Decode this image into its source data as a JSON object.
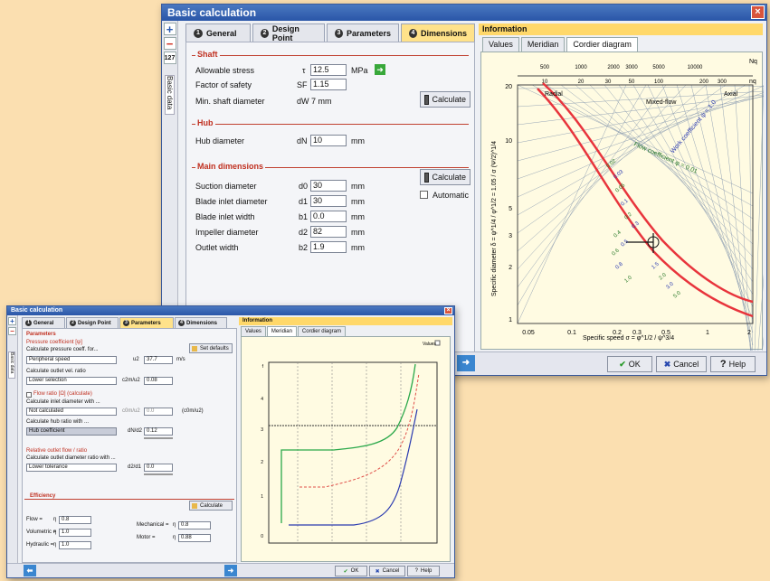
{
  "back": {
    "title": "Basic calculation",
    "close": "×",
    "tools": [
      "+",
      "−",
      "127"
    ],
    "side_tab": "Basic data",
    "tabs": [
      {
        "n": "1",
        "label": "General"
      },
      {
        "n": "2",
        "label": "Design Point"
      },
      {
        "n": "3",
        "label": "Parameters"
      },
      {
        "n": "4",
        "label": "Dimensions"
      }
    ],
    "shaft": {
      "title": "Shaft",
      "allowable_stress": {
        "label": "Allowable stress",
        "sym": "τ",
        "value": "12.5",
        "unit": "MPa"
      },
      "safety": {
        "label": "Factor of safety",
        "sym": "SF",
        "value": "1.15"
      },
      "min_diam": {
        "label": "Min. shaft diameter",
        "sym": "dW",
        "value": "7 mm"
      },
      "calc_label": "Calculate"
    },
    "hub": {
      "title": "Hub",
      "label": "Hub diameter",
      "sym": "dN",
      "value": "10",
      "unit": "mm"
    },
    "main": {
      "title": "Main dimensions",
      "calc_label": "Calculate",
      "auto_label": "Automatic",
      "rows": [
        {
          "label": "Suction diameter",
          "sym": "d0",
          "value": "30",
          "unit": "mm"
        },
        {
          "label": "Blade inlet diameter",
          "sym": "d1",
          "value": "30",
          "unit": "mm"
        },
        {
          "label": "Blade inlet width",
          "sym": "b1",
          "value": "0.0",
          "unit": "mm"
        },
        {
          "label": "Impeller diameter",
          "sym": "d2",
          "value": "82",
          "unit": "mm"
        },
        {
          "label": "Outlet width",
          "sym": "b2",
          "value": "1.9",
          "unit": "mm"
        }
      ]
    },
    "info": {
      "title": "Information",
      "subtabs": [
        "Values",
        "Meridian",
        "Cordier diagram"
      ],
      "diagram": {
        "top_ticks_a": [
          "500",
          "1000",
          "2000",
          "3000",
          "5000",
          "10000"
        ],
        "top_ticks_b": [
          "10",
          "20",
          "30",
          "50",
          "100",
          "200",
          "300"
        ],
        "top_label_a": "Nq",
        "top_label_b": "nq",
        "regions": [
          "Radial",
          "Mixed-flow",
          "Axial"
        ],
        "y_ticks": [
          "20",
          "10",
          "5",
          "3",
          "2",
          "1"
        ],
        "x_ticks": [
          "0.05",
          "0.1",
          "0.2",
          "0.3",
          "0.5",
          "1",
          "2"
        ],
        "xlabel": "Specific speed σ = φ^1/2 / ψ^3/4",
        "ylabel": "Specific diameter δ = ψ^1/4 / φ^1/2 = 1.05 / σ (Ψ/2)^1/4",
        "annotation_1": "Flow coefficient φ = 0.01",
        "annotation_2": "Work coefficient ψ = 1.0",
        "curve_labels": [
          "0.02",
          "0.03",
          "0.05",
          "0.1",
          "0.2",
          "0.3",
          "0.4",
          "0.5",
          "0.6",
          "0.8",
          "1.0",
          "1.5",
          "2.0",
          "3.0",
          "5.0"
        ],
        "colors": {
          "band": "#e8343c",
          "grid": "#7a8eaa"
        }
      }
    },
    "buttons": {
      "ok": "OK",
      "cancel": "Cancel",
      "help": "Help"
    }
  },
  "front": {
    "title": "Basic calculation",
    "tabs": [
      {
        "n": "1",
        "label": "General"
      },
      {
        "n": "2",
        "label": "Design Point"
      },
      {
        "n": "3",
        "label": "Parameters"
      },
      {
        "n": "4",
        "label": "Dimensions"
      }
    ],
    "params": {
      "title": "Parameters",
      "sub": "Pressure coefficient [ψ]",
      "sub2": "Calculate pressure coeff. for...",
      "default_btn": "Set defaults",
      "select1": "Peripheral speed",
      "f1_sym": "u2",
      "f1_val": "37.7",
      "f1_unit": "m/s",
      "sub3": "Calculate outlet vel. ratio",
      "select2": "Lower selection",
      "f2_sym": "c2m/u2",
      "f2_val": "0.08",
      "check1": "Flow ratio [Ω] (calculate)",
      "sub4": "Calculate inlet diameter with ...",
      "select3": "Not calculated",
      "f3_sym": "c0m/u2",
      "f3_val": "0.0",
      "f3_unit": "(c0m/u2)",
      "sub5": "Calculate hub ratio with ...",
      "select4": "Hub coefficient",
      "f4_sym": "dN/d2",
      "f4_val": "0.12",
      "sec2_title": "Relative outlet flow / ratio",
      "sec2_sub": "Calculate outlet diameter ratio with ...",
      "select5": "Lower tolerance",
      "f5_sym": "d2/d1",
      "f5_val": "0.0"
    },
    "eff": {
      "title": "Efficiency",
      "calc_btn": "Calculate",
      "rows": [
        {
          "label": "Flow =",
          "sym": "η",
          "val": "0.8"
        },
        {
          "label": "Volumetric =",
          "sym": "η",
          "val": "1.0"
        },
        {
          "label": "Hydraulic =",
          "sym": "η",
          "val": "1.0"
        }
      ],
      "rows2": [
        {
          "label": "Mechanical =",
          "sym": "η",
          "val": "0.8"
        },
        {
          "label": "Motor =",
          "sym": "η",
          "val": "0.88"
        }
      ]
    },
    "info": {
      "title": "Information",
      "subtabs": [
        "Values",
        "Meridian",
        "Cordier diagram"
      ],
      "checkbox": "Values",
      "y_ticks": [
        "f",
        "4",
        "3",
        "2",
        "1",
        "0"
      ],
      "colors": {
        "green": "#2aa84a",
        "red": "#e0504a",
        "blue": "#2a3ab0"
      }
    },
    "buttons": {
      "ok": "OK",
      "cancel": "Cancel",
      "help": "Help"
    }
  }
}
